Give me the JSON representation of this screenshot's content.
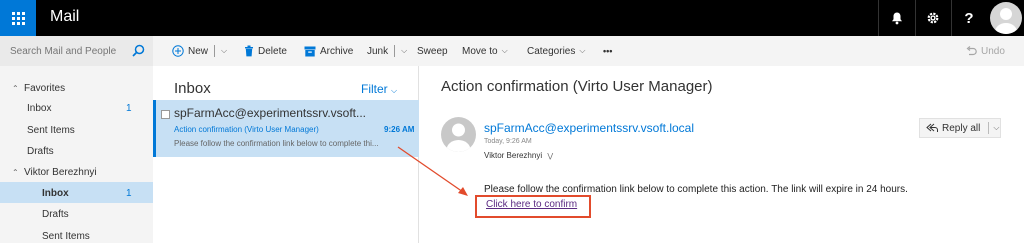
{
  "app": {
    "title": "Mail"
  },
  "search": {
    "placeholder": "Search Mail and People"
  },
  "toolbar": {
    "new_label": "New",
    "delete_label": "Delete",
    "archive_label": "Archive",
    "junk_label": "Junk",
    "sweep_label": "Sweep",
    "moveto_label": "Move to",
    "categories_label": "Categories",
    "more_label": "•••",
    "undo_label": "Undo"
  },
  "sidebar": {
    "favorites_label": "Favorites",
    "favorites": [
      {
        "label": "Inbox",
        "count": "1"
      },
      {
        "label": "Sent Items",
        "count": ""
      },
      {
        "label": "Drafts",
        "count": ""
      }
    ],
    "account_label": "Viktor Berezhnyi",
    "account_items": [
      {
        "label": "Inbox",
        "count": "1"
      },
      {
        "label": "Drafts",
        "count": ""
      },
      {
        "label": "Sent Items",
        "count": ""
      }
    ]
  },
  "list": {
    "title": "Inbox",
    "filter_label": "Filter",
    "messages": [
      {
        "from": "spFarmAcc@experimentssrv.vsoft...",
        "subject": "Action confirmation (Virto User Manager)",
        "time": "9:26 AM",
        "preview": "Please follow the confirmation link below to complete thi..."
      }
    ]
  },
  "reading": {
    "subject": "Action confirmation (Virto User Manager)",
    "from": "spFarmAcc@experimentssrv.vsoft.local",
    "date": "Today, 9:26 AM",
    "to": "Viktor Berezhnyi",
    "reply_all_label": "Reply all",
    "body": "Please follow the confirmation link below to complete this action. The link will expire in 24 hours.",
    "link_text": "Click here to confirm"
  },
  "colors": {
    "accent": "#0078d7",
    "selected_bg": "#c7e0f4",
    "annotation": "#e24b2c",
    "topbar": "#000000"
  },
  "icons": [
    "waffle-icon",
    "bell-icon",
    "gear-icon",
    "help-icon",
    "user-avatar-icon",
    "search-icon",
    "plus-circle-icon",
    "trash-icon",
    "archive-icon",
    "undo-icon",
    "reply-all-icon"
  ]
}
